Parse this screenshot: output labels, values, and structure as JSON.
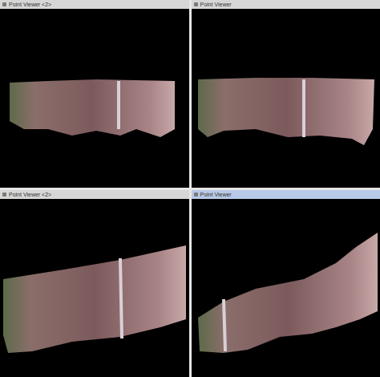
{
  "windows": [
    {
      "title": "Point Viewer <2>",
      "active": false
    },
    {
      "title": "Point Viewer",
      "active": false
    },
    {
      "title": "Point Viewer <2>",
      "active": false
    },
    {
      "title": "Point Viewer",
      "active": true
    }
  ]
}
